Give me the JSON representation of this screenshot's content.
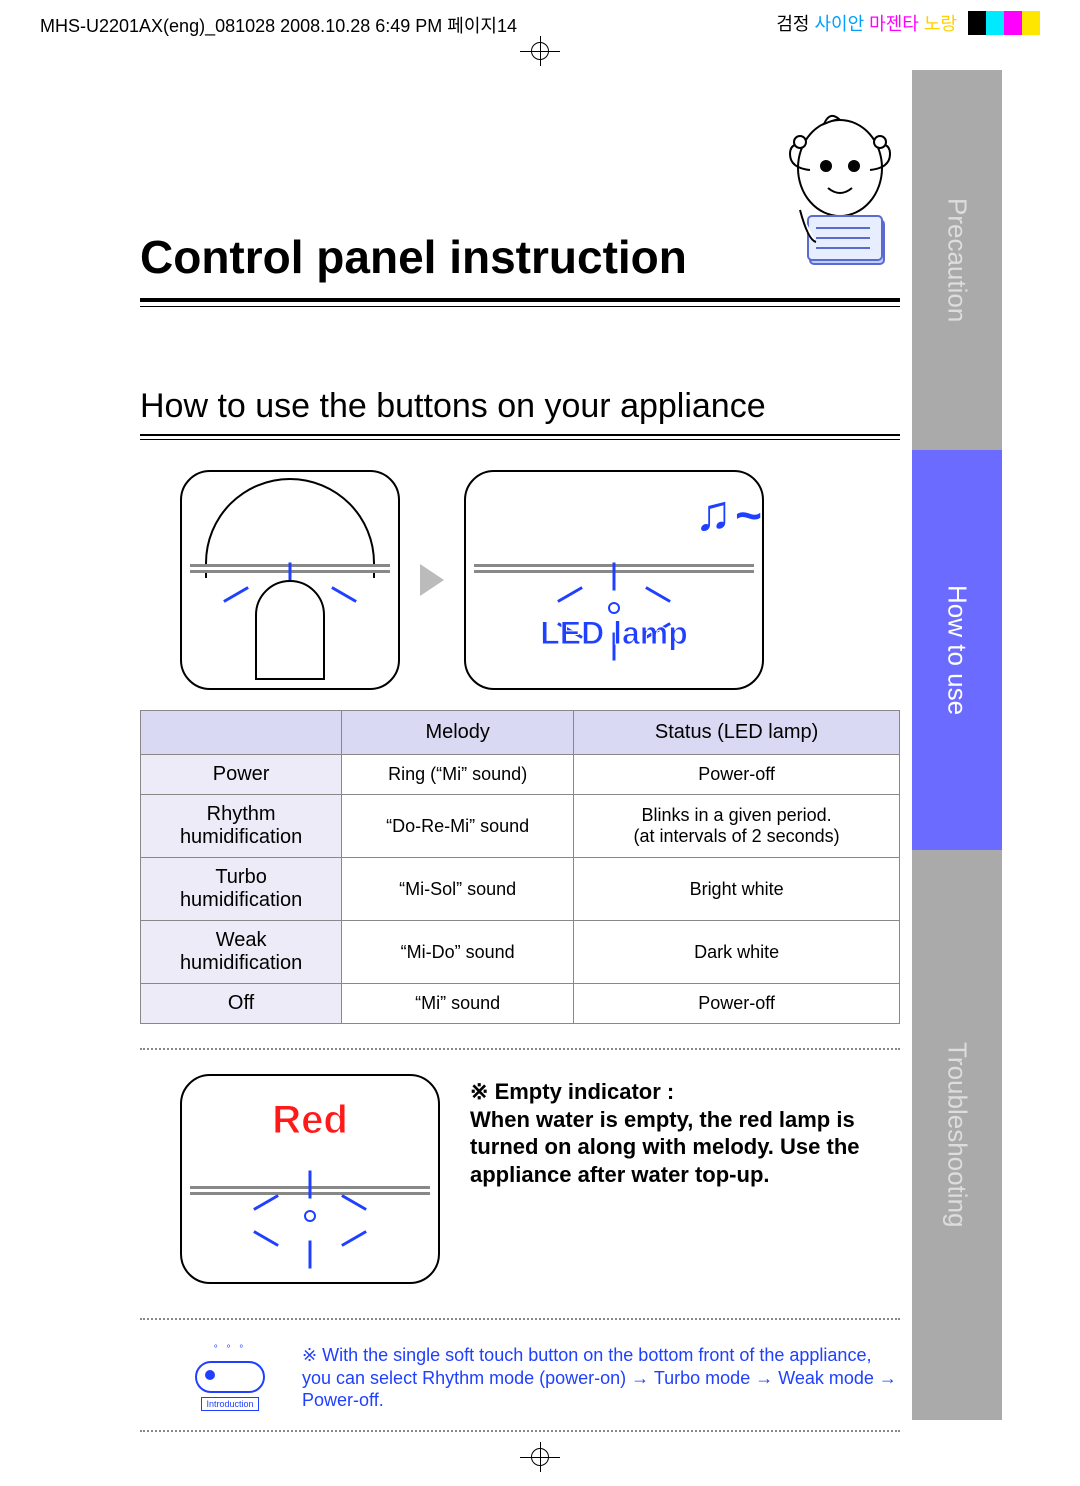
{
  "header": {
    "file_info": "MHS-U2201AX(eng)_081028  2008.10.28 6:49 PM  페이지14",
    "cmyk": {
      "k1": "검정",
      "k2": "사이안",
      "k3": "마젠타",
      "k4": "노랑"
    }
  },
  "side_tabs": {
    "precaution": "Precaution",
    "how_to_use": "How to use",
    "troubleshooting": "Troubleshooting"
  },
  "title": "Control panel instruction",
  "section": "How to use the buttons on your appliance",
  "illus": {
    "led_lamp_label": "LED lamp",
    "music_note": "♫",
    "tilde": "~"
  },
  "table": {
    "col_melody": "Melody",
    "col_status": "Status (LED lamp)",
    "rows": [
      {
        "label": "Power",
        "melody": "Ring (“Mi” sound)",
        "status": "Power-off"
      },
      {
        "label": "Rhythm\nhumidification",
        "melody": "“Do-Re-Mi” sound",
        "status": "Blinks in a given period.\n(at intervals of 2 seconds)"
      },
      {
        "label": "Turbo\nhumidification",
        "melody": "“Mi-Sol” sound",
        "status": "Bright white"
      },
      {
        "label": "Weak\nhumidification",
        "melody": "“Mi-Do” sound",
        "status": "Dark white"
      },
      {
        "label": "Off",
        "melody": "“Mi” sound",
        "status": "Power-off"
      }
    ]
  },
  "empty_indicator": {
    "red_label": "Red",
    "mark": "※",
    "heading": "Empty indicator :",
    "body": "When water is empty, the red lamp is turned on along with melody. Use the appliance after water top-up."
  },
  "note": {
    "intro_label": "Introduction",
    "mark": "※",
    "text": "With the single soft touch button on the bottom front of the appliance, you can select Rhythm mode (power-on) → Turbo mode →  Weak mode → Power-off."
  }
}
